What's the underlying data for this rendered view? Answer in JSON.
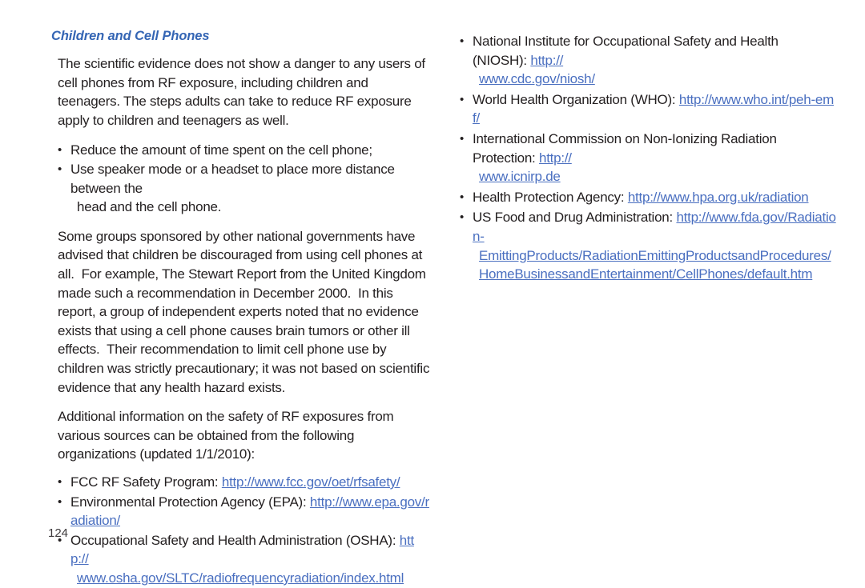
{
  "page": {
    "number": "124",
    "heading": "Children and Cell Phones",
    "heading_color": "#3465b4",
    "link_color": "#4a6fc0",
    "text_color": "#231f20",
    "background": "#ffffff"
  },
  "left_column": {
    "intro_paragraph": "The scientific evidence does not show a danger to any users of cell phones from RF exposure, including children and teenagers. The steps adults can take to reduce RF exposure apply to children and teenagers as well.",
    "tips": [
      {
        "text": "Reduce the amount of time spent on the cell phone;",
        "cont": ""
      },
      {
        "text": "Use speaker mode or a headset to place more distance between the",
        "cont": "head and the cell phone."
      }
    ],
    "stewart_paragraph": "Some groups sponsored by other national governments have advised that children be discouraged from using cell phones at all.  For example, The Stewart Report from the United Kingdom made such a recommendation in December 2000.  In this report, a group of independent experts noted that no evidence exists that using a cell phone causes brain tumors or other ill effects.  Their recommendation to limit cell phone use by children was strictly precautionary; it was not based on scientific evidence that any health hazard exists.",
    "additional_info_paragraph": "Additional information on the safety of RF exposures from various sources can be obtained from the following organizations (updated 1/1/2010):",
    "organizations": [
      {
        "label": "FCC RF Safety Program: ",
        "url": "http://www.fcc.gov/oet/rfsafety/",
        "url_cont": ""
      },
      {
        "label": "Environmental Protection Agency (EPA): ",
        "url": "http://www.epa.gov/radiation/",
        "url_cont": ""
      },
      {
        "label": "Occupational Safety and Health Administration (OSHA): ",
        "url": "http://",
        "url_cont": "www.osha.gov/SLTC/radiofrequencyradiation/index.html"
      }
    ]
  },
  "right_column": {
    "organizations": [
      {
        "label": "National Institute for Occupational Safety and Health (NIOSH): ",
        "url": "http://",
        "url_cont": "www.cdc.gov/niosh/",
        "url_cont2": ""
      },
      {
        "label": "World Health Organization (WHO): ",
        "url": "http://www.who.int/peh-emf/",
        "url_cont": "",
        "url_cont2": ""
      },
      {
        "label": "International Commission on Non-Ionizing Radiation Protection: ",
        "url": "http://",
        "url_cont": "www.icnirp.de",
        "url_cont2": ""
      },
      {
        "label": "Health Protection Agency: ",
        "url": "http://www.hpa.org.uk/radiation",
        "url_cont": "",
        "url_cont2": ""
      },
      {
        "label": "US Food and Drug Administration: ",
        "url": "http://www.fda.gov/Radiation-",
        "url_cont": "EmittingProducts/RadiationEmittingProductsandProcedures/",
        "url_cont2": "HomeBusinessandEntertainment/CellPhones/default.htm"
      }
    ]
  }
}
